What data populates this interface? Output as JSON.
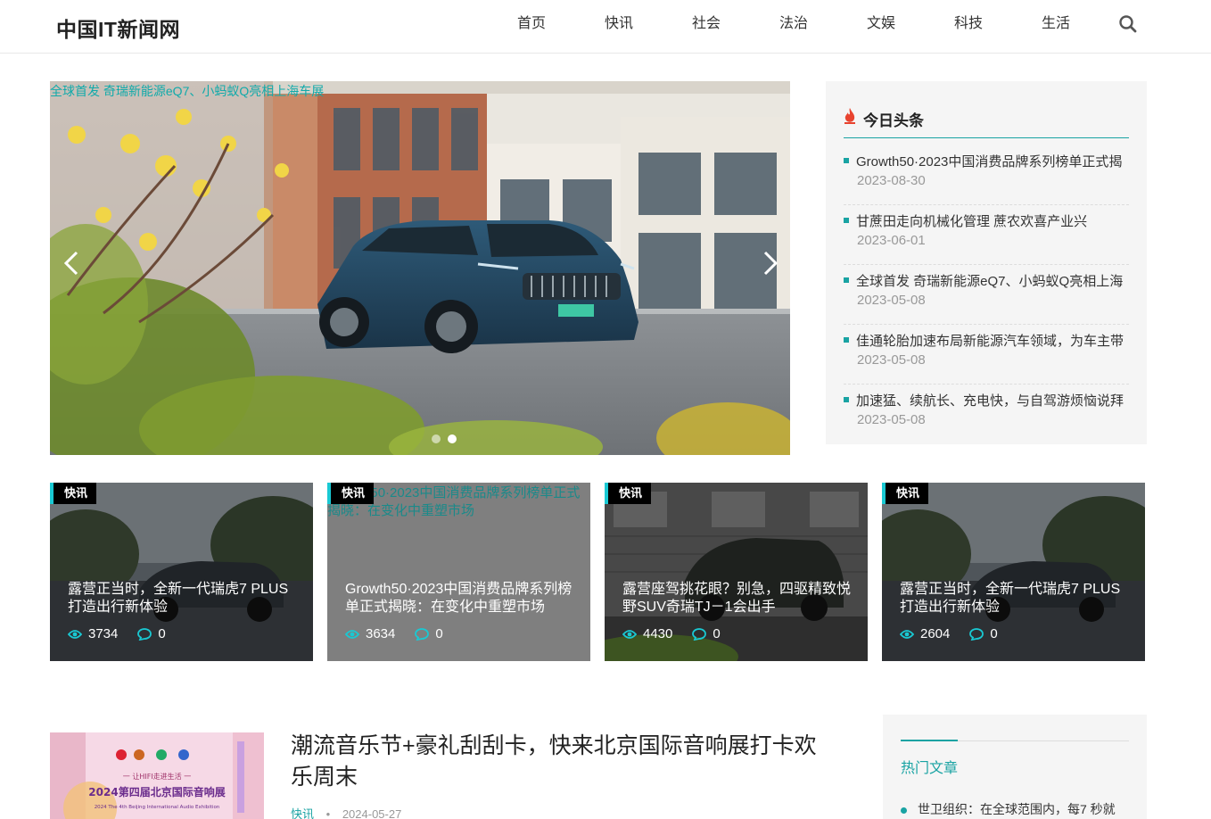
{
  "site": {
    "logo": "中国IT新闻网"
  },
  "nav": {
    "items": [
      "首页",
      "快讯",
      "社会",
      "法治",
      "文娱",
      "科技",
      "生活"
    ]
  },
  "hero": {
    "image_alt": "全球首发 奇瑞新能源eQ7、小蚂蚁Q亮相上海车展",
    "active_slide": 2,
    "slide_count": 2
  },
  "today": {
    "title": "今日头条",
    "items": [
      {
        "title": "Growth50·2023中国消费品牌系列榜单正式揭",
        "date": "2023-08-30"
      },
      {
        "title": "甘蔗田走向机械化管理 蔗农欢喜产业兴",
        "date": "2023-06-01"
      },
      {
        "title": "全球首发 奇瑞新能源eQ7、小蚂蚁Q亮相上海",
        "date": "2023-05-08"
      },
      {
        "title": "佳通轮胎加速布局新能源汽车领域，为车主带",
        "date": "2023-05-08"
      },
      {
        "title": "加速猛、续航长、充电快，与自驾游烦恼说拜",
        "date": "2023-05-08"
      }
    ]
  },
  "cards": [
    {
      "tag": "快讯",
      "title": "露营正当时，全新一代瑞虎7 PLUS打造出行新体验",
      "views": "3734",
      "comments": "0",
      "alt": ""
    },
    {
      "tag": "快讯",
      "title": "Growth50·2023中国消费品牌系列榜单正式揭晓：在变化中重塑市场",
      "views": "3634",
      "comments": "0",
      "alt": "Growth50·2023中国消费品牌系列榜单正式揭晓：在变化中重塑市场"
    },
    {
      "tag": "快讯",
      "title": "露营座驾挑花眼？别急，四驱精致悦野SUV奇瑞TJ－1会出手",
      "views": "4430",
      "comments": "0",
      "alt": ""
    },
    {
      "tag": "快讯",
      "title": "露营正当时，全新一代瑞虎7 PLUS打造出行新体验",
      "views": "2604",
      "comments": "0",
      "alt": ""
    }
  ],
  "article": {
    "title": "潮流音乐节+豪礼刮刮卡，快来北京国际音响展打卡欢乐周末",
    "category": "快讯",
    "separator": "•",
    "date": "2024-05-27",
    "thumb_text_1": "一 让HIFI走进生活 一",
    "thumb_text_2": "2024第四届北京国际音响展",
    "thumb_text_3": "2024 The 4th Beijing International Audio Exhibition"
  },
  "hot": {
    "title": "热门文章",
    "items": [
      "世卫组织：在全球范围内，每7 秒就"
    ]
  },
  "colors": {
    "accent": "#19a3a3",
    "tag_bar": "#19c9d3"
  }
}
